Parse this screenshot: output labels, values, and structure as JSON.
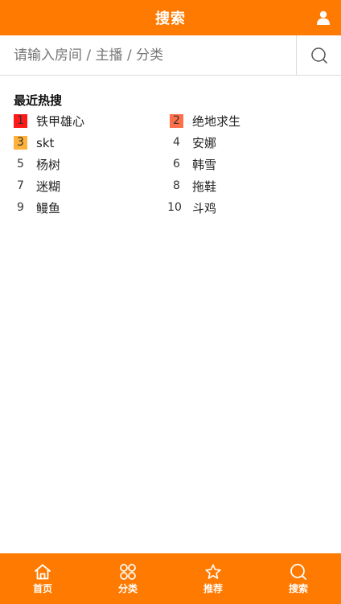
{
  "header": {
    "title": "搜索",
    "user_icon": "user-icon"
  },
  "search": {
    "placeholder": "请输入房间 / 主播 / 分类",
    "value": "",
    "icon": "search-icon"
  },
  "hot_search": {
    "heading": "最近热搜",
    "items": [
      {
        "rank": "1",
        "name": "铁甲雄心",
        "badge_color": "#ff1a1a"
      },
      {
        "rank": "2",
        "name": "绝地求生",
        "badge_color": "#ff6f4a"
      },
      {
        "rank": "3",
        "name": "skt",
        "badge_color": "#ffb23a"
      },
      {
        "rank": "4",
        "name": "安娜",
        "badge_color": ""
      },
      {
        "rank": "5",
        "name": "杨树",
        "badge_color": ""
      },
      {
        "rank": "6",
        "name": "韩雪",
        "badge_color": ""
      },
      {
        "rank": "7",
        "name": "迷糊",
        "badge_color": ""
      },
      {
        "rank": "8",
        "name": "拖鞋",
        "badge_color": ""
      },
      {
        "rank": "9",
        "name": "鳗鱼",
        "badge_color": ""
      },
      {
        "rank": "10",
        "name": "斗鸡",
        "badge_color": ""
      }
    ]
  },
  "tabbar": {
    "tabs": [
      {
        "label": "首页",
        "icon": "home-icon"
      },
      {
        "label": "分类",
        "icon": "category-icon"
      },
      {
        "label": "推荐",
        "icon": "star-icon"
      },
      {
        "label": "搜索",
        "icon": "search-icon"
      }
    ]
  },
  "colors": {
    "brand": "#ff7a00"
  }
}
